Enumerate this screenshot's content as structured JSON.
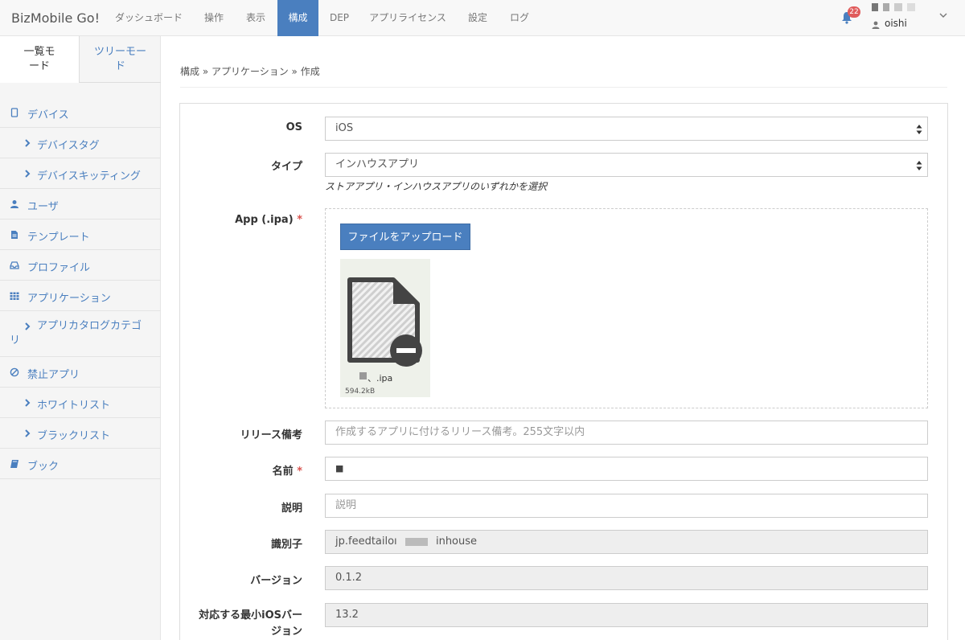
{
  "navbar": {
    "brand": "BizMobile Go!",
    "items": [
      {
        "label": "ダッシュボード"
      },
      {
        "label": "操作"
      },
      {
        "label": "表示"
      },
      {
        "label": "構成",
        "active": true
      },
      {
        "label": "DEP"
      },
      {
        "label": "アプリライセンス"
      },
      {
        "label": "設定"
      },
      {
        "label": "ログ"
      }
    ],
    "notification_count": "22",
    "user_name": "oishi"
  },
  "sidebar": {
    "modes": {
      "list": "一覧モード",
      "tree": "ツリーモード"
    },
    "items": [
      {
        "label": "デバイス",
        "icon": "mobile-icon"
      },
      {
        "label": "デバイスタグ",
        "icon": "chevron-right-icon"
      },
      {
        "label": "デバイスキッティング",
        "icon": "chevron-right-icon"
      },
      {
        "label": "ユーザ",
        "icon": "user-icon"
      },
      {
        "label": "テンプレート",
        "icon": "file-text-icon"
      },
      {
        "label": "プロファイル",
        "icon": "inbox-icon"
      },
      {
        "label": "アプリケーション",
        "icon": "grid-icon"
      },
      {
        "label": "アプリカタログカテゴリ",
        "icon": "chevron-right-icon"
      },
      {
        "label": "禁止アプリ",
        "icon": "ban-icon"
      },
      {
        "label": "ホワイトリスト",
        "icon": "chevron-right-icon"
      },
      {
        "label": "ブラックリスト",
        "icon": "chevron-right-icon"
      },
      {
        "label": "ブック",
        "icon": "book-icon"
      }
    ]
  },
  "breadcrumb": "構成 » アプリケーション » 作成",
  "form": {
    "os": {
      "label": "OS",
      "value": "iOS"
    },
    "type": {
      "label": "タイプ",
      "value": "インハウスアプリ",
      "help": "ストアアプリ・インハウスアプリのいずれかを選択"
    },
    "app": {
      "label": "App (.ipa)",
      "required_mark": "*",
      "upload_label": "ファイルをアップロード",
      "file_name": "、.ipa",
      "file_size": "594.2kB"
    },
    "release_note": {
      "label": "リリース備考",
      "placeholder": "作成するアプリに付けるリリース備考。255文字以内"
    },
    "name": {
      "label": "名前",
      "required_mark": "*",
      "value": "■"
    },
    "description": {
      "label": "説明",
      "placeholder": "説明"
    },
    "identifier": {
      "label": "識別子",
      "value_prefix": "jp.feedtailoı",
      "value_suffix": "inhouse"
    },
    "version": {
      "label": "バージョン",
      "value": "0.1.2"
    },
    "min_ios": {
      "label": "対応する最小iOSバージョン",
      "value": "13.2"
    }
  },
  "colors": {
    "accent": "#4a7fbf",
    "badge": "#e05b5b",
    "required": "#d9534f"
  }
}
